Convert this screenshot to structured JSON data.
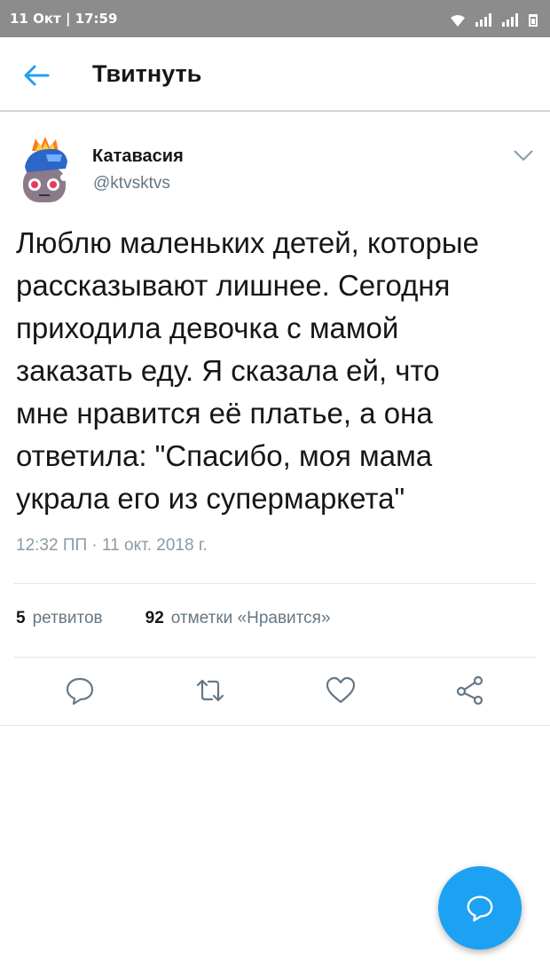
{
  "status_bar": {
    "date_time": "11 Окт | 17:59",
    "icons": [
      "wifi-icon",
      "signal-icon",
      "signal-icon",
      "battery-icon"
    ]
  },
  "header": {
    "title": "Твитнуть",
    "back_icon": "arrow-left-icon"
  },
  "tweet": {
    "author": {
      "name": "Катавасия",
      "handle": "@ktvsktvs"
    },
    "text": "Люблю маленьких детей, которые\nрассказывают лишнее. Сегодня\nприходила девочка с мамой\nзаказать еду. Я сказала ей, что\nмне нравится её платье, а она\nответила: \"Спасибо, моя мама\nукрала его из супермаркета\"",
    "timestamp": "12:32 ПП · 11 окт. 2018 г.",
    "retweets": {
      "count": "5",
      "label": "ретвитов"
    },
    "likes": {
      "count": "92",
      "label": "отметки «Нравится»"
    },
    "actions": [
      "reply-icon",
      "retweet-icon",
      "like-icon",
      "share-icon"
    ]
  },
  "fab": {
    "icon": "compose-icon"
  },
  "colors": {
    "accent": "#1da1f2",
    "secondary_text": "#657786",
    "status_bar": "#8c8c8c"
  }
}
